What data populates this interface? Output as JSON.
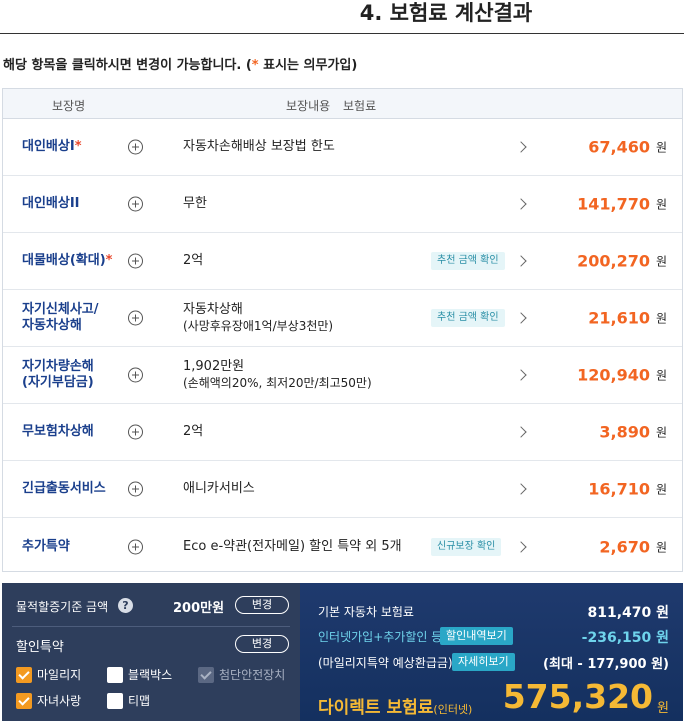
{
  "title": "4. 보험료 계산결과",
  "description": {
    "prefix": "해당 항목을 클릭하시면 변경이 가능합니다. (",
    "star": "*",
    "suffix": " 표시는 의무가입)"
  },
  "table": {
    "headers": {
      "name": "보장명",
      "content": "보장내용",
      "premium": "보험료"
    },
    "currency": "원",
    "rows": [
      {
        "name": "대인배상I",
        "required": "*",
        "content": "자동차손해배상 보장법 한도",
        "sub": "",
        "badge": "",
        "amount": "67,460"
      },
      {
        "name": "대인배상II",
        "required": "",
        "content": "무한",
        "sub": "",
        "badge": "",
        "amount": "141,770"
      },
      {
        "name": "대물배상(확대)",
        "required": "*",
        "content": "2억",
        "sub": "",
        "badge": "추천 금액 확인",
        "amount": "200,270"
      },
      {
        "name": "자기신체사고/\n자동차상해",
        "required": "",
        "content": "자동차상해",
        "sub": "(사망후유장애1억/부상3천만)",
        "badge": "추천 금액 확인",
        "amount": "21,610"
      },
      {
        "name": "자기차량손해\n(자기부담금)",
        "required": "",
        "content": "1,902만원",
        "sub": "(손해액의20%, 최저20만/최고50만)",
        "badge": "",
        "amount": "120,940"
      },
      {
        "name": "무보험차상해",
        "required": "",
        "content": "2억",
        "sub": "",
        "badge": "",
        "amount": "3,890"
      },
      {
        "name": "긴급출동서비스",
        "required": "",
        "content": "애니카서비스",
        "sub": "",
        "badge": "",
        "amount": "16,710"
      },
      {
        "name": "추가특약",
        "required": "",
        "content": "Eco e-약관(전자메일) 할인 특약 외 5개",
        "sub": "",
        "badge": "신규보장 확인",
        "amount": "2,670"
      }
    ]
  },
  "left_panel": {
    "base_amount_label": "물적할증기준 금액",
    "help_icon": "?",
    "base_amount": "200만원",
    "change_label": "변경",
    "discount_label": "할인특약",
    "checks": [
      {
        "label": "마일리지",
        "state": "on"
      },
      {
        "label": "블랙박스",
        "state": "off"
      },
      {
        "label": "첨단안전장치",
        "state": "dis"
      },
      {
        "label": "자녀사랑",
        "state": "on"
      },
      {
        "label": "티맵",
        "state": "off"
      }
    ]
  },
  "right_panel": {
    "basic_label": "기본 자동차 보험료",
    "basic_value": "811,470 원",
    "discount_label": "인터넷가입+추가할인 등",
    "discount_badge": "할인내역보기",
    "discount_value": "-236,150 원",
    "mileage_label": "(마일리지특약 예상환급금)",
    "mileage_badge": "자세히보기",
    "mileage_value": "(최대 - 177,900 원)",
    "final_label": "다이렉트 보험료",
    "final_sub": "(인터넷)",
    "final_value": "575,320",
    "final_won": "원"
  },
  "colors": {
    "accent": "#f26522",
    "navy": "#1a3f8c",
    "gold": "#f5b935",
    "cyan": "#6fd4ec"
  }
}
